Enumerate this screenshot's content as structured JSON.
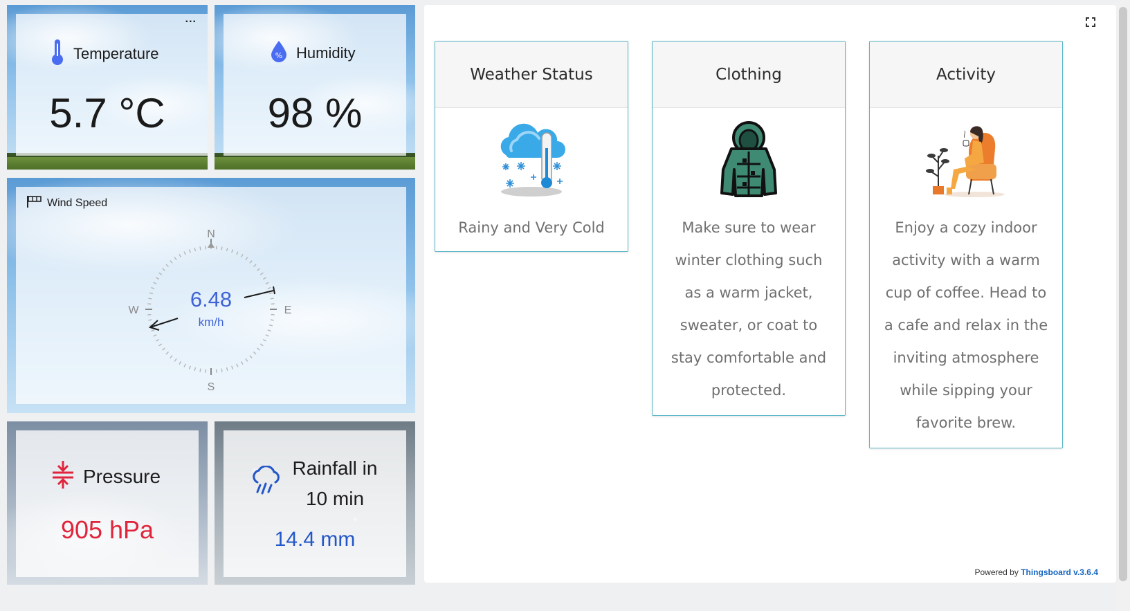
{
  "temperature": {
    "label": "Temperature",
    "value": "5.7 °C",
    "menu": "..."
  },
  "humidity": {
    "label": "Humidity",
    "value": "98 %"
  },
  "wind": {
    "label": "Wind Speed",
    "value": "6.48",
    "unit": "km/h",
    "directions": {
      "n": "N",
      "e": "E",
      "s": "S",
      "w": "W"
    }
  },
  "pressure": {
    "label": "Pressure",
    "value": "905 hPa",
    "color": "#e0243b"
  },
  "rainfall": {
    "label_line1": "Rainfall in",
    "label_line2": "10 min",
    "value": "14.4 mm",
    "color": "#2356c8"
  },
  "cards": [
    {
      "title": "Weather Status",
      "text": "Rainy and Very Cold",
      "icon": "snow-cloud-thermometer-icon"
    },
    {
      "title": "Clothing",
      "text": "Make sure to wear winter clothing such as a warm jacket, sweater, or coat to stay comfortable and protected.",
      "icon": "winter-jacket-icon"
    },
    {
      "title": "Activity",
      "text": "Enjoy a cozy indoor activity with a warm cup of coffee. Head to a cafe and relax in the inviting atmosphere while sipping your favorite brew.",
      "icon": "woman-with-coffee-icon"
    }
  ],
  "footer": {
    "prefix": "Powered by",
    "brand": "Thingsboard v.3.6.4"
  },
  "colors": {
    "card_border": "#5bb6c9",
    "wind_value": "#3f63d6",
    "icon_blue": "#4a6cf0"
  }
}
